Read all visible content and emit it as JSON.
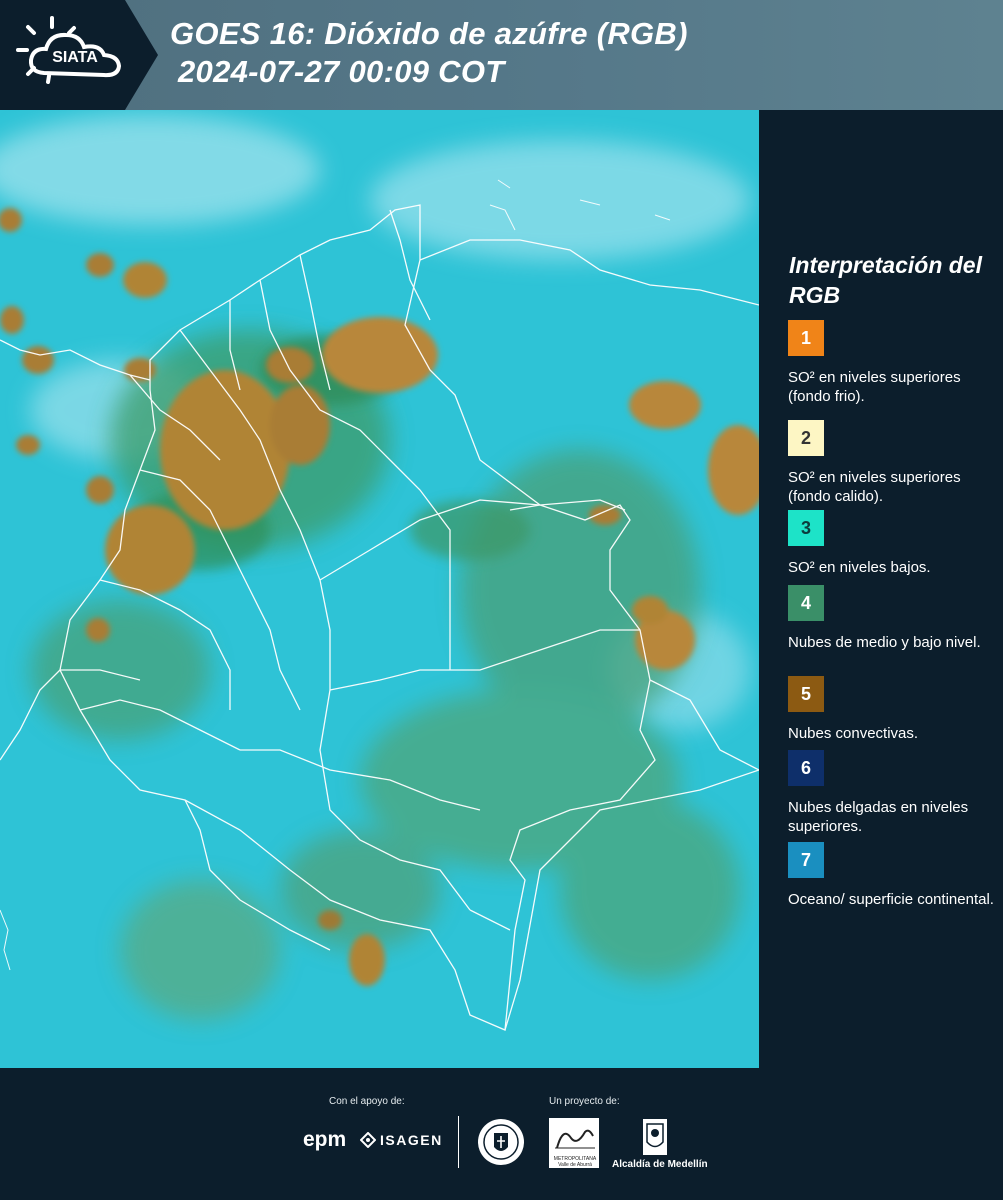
{
  "header": {
    "logo_text": "SIATA",
    "title_line1": "GOES 16: Dióxido de azúfre (RGB)",
    "title_line2": "2024-07-27 00:09 COT"
  },
  "map": {
    "ocean_color": "#2bc4d8",
    "convective_color": "#b8883a",
    "midlevel_color": "#3f9a68",
    "border_color": "#ffffff"
  },
  "legend": {
    "title": "Interpretación del RGB",
    "items": [
      {
        "number": "1",
        "label": "SO² en niveles superiores (fondo frio).",
        "color": "#f08418",
        "text_color": "#ffffff"
      },
      {
        "number": "2",
        "label": "SO² en niveles superiores (fondo calido).",
        "color": "#fdf6c4",
        "text_color": "#333333"
      },
      {
        "number": "3",
        "label": "SO² en niveles bajos.",
        "color": "#1de3c8",
        "text_color": "#0c3c3c"
      },
      {
        "number": "4",
        "label": "Nubes de medio y bajo nivel.",
        "color": "#3a8f68",
        "text_color": "#ffffff"
      },
      {
        "number": "5",
        "label": "Nubes convectivas.",
        "color": "#8c5a12",
        "text_color": "#ffffff"
      },
      {
        "number": "6",
        "label": "Nubes delgadas en niveles superiores.",
        "color": "#0e2f6a",
        "text_color": "#ffffff"
      },
      {
        "number": "7",
        "label": "Oceano/ superficie continental.",
        "color": "#1a8fc0",
        "text_color": "#ffffff"
      }
    ]
  },
  "footer": {
    "support_label": "Con el apoyo de:",
    "project_label": "Un proyecto de:",
    "sponsor1": "epm",
    "sponsor2": "ISAGEN",
    "amva_name": "METROPOLITANA Valle de Aburrá",
    "alcaldia_name": "Alcaldía de Medellín"
  }
}
